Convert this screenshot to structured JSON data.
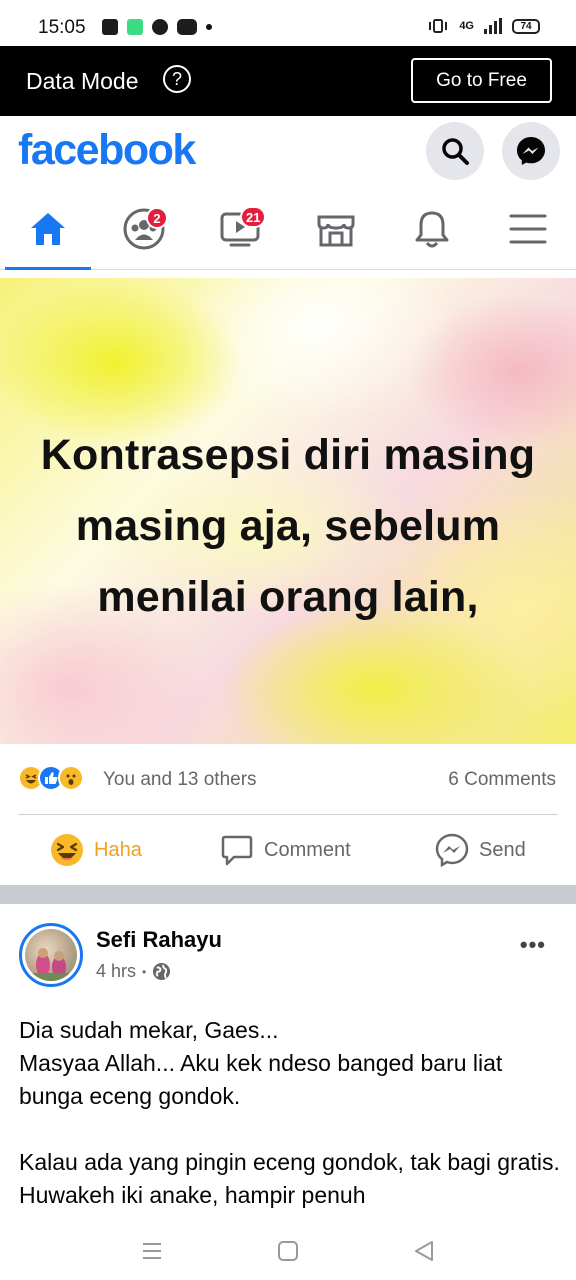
{
  "status_bar": {
    "time": "15:05",
    "network": "4G",
    "battery": "74"
  },
  "data_mode": {
    "label": "Data Mode",
    "help_icon": "?",
    "go_free_label": "Go to Free"
  },
  "header": {
    "logo": "facebook",
    "search_icon": "search-icon",
    "messenger_icon": "messenger-icon"
  },
  "tabs": [
    {
      "name": "home",
      "icon": "home-icon",
      "active": true,
      "badge": ""
    },
    {
      "name": "groups",
      "icon": "groups-icon",
      "active": false,
      "badge": "2"
    },
    {
      "name": "watch",
      "icon": "watch-icon",
      "active": false,
      "badge": "21"
    },
    {
      "name": "marketplace",
      "icon": "marketplace-icon",
      "active": false,
      "badge": ""
    },
    {
      "name": "notifications",
      "icon": "bell-icon",
      "active": false,
      "badge": ""
    },
    {
      "name": "menu",
      "icon": "menu-icon",
      "active": false,
      "badge": ""
    }
  ],
  "post1": {
    "image_text_line1": "Kontrasepsi diri masing",
    "image_text_line2": "masing aja, sebelum",
    "image_text_line3": "menilai orang lain,",
    "reactions_text": "You and 13 others",
    "comments_count": "6 Comments",
    "actions": {
      "haha": "Haha",
      "comment": "Comment",
      "send": "Send"
    }
  },
  "post2": {
    "author": "Sefi Rahayu",
    "time": "4 hrs",
    "separator": "•",
    "more": "•••",
    "body": "Dia sudah mekar, Gaes...\nMasyaa Allah... Aku kek ndeso banged baru liat bunga eceng gondok.\n\nKalau ada yang pingin eceng gondok, tak bagi gratis. Huwakeh iki anake, hampir penuh"
  },
  "colors": {
    "brand": "#1877f2",
    "badge": "#e41e3f",
    "haha": "#f7b928",
    "muted_text": "#65676b"
  }
}
